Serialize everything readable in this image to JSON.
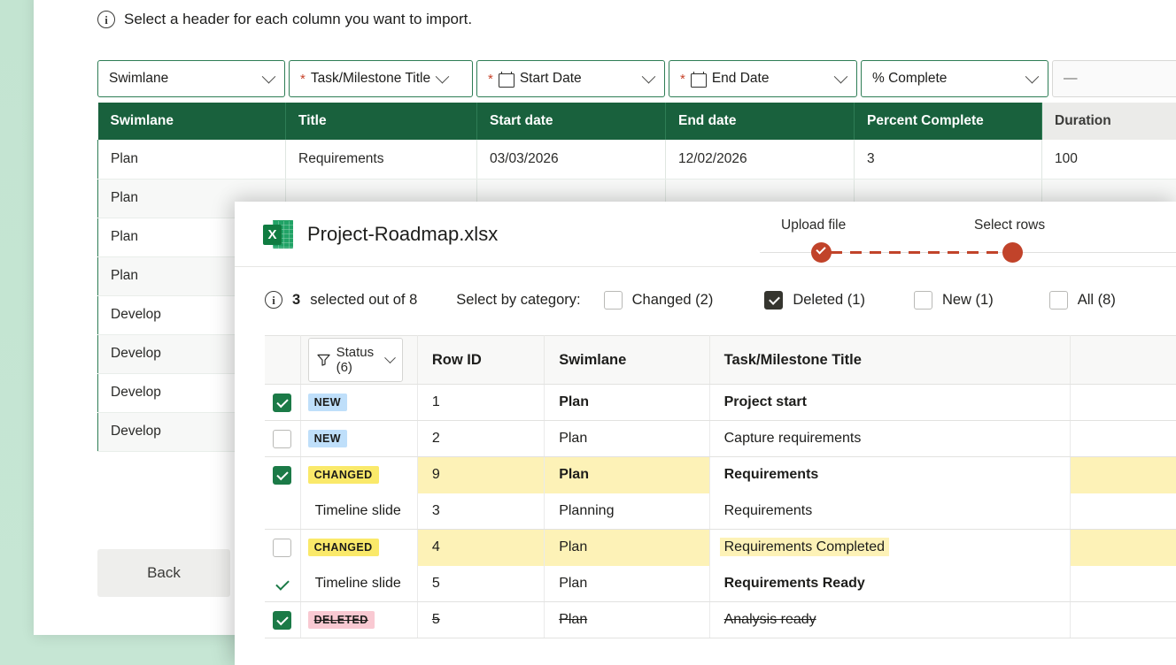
{
  "page": {
    "info_text": "Select a header for each column you want to import.",
    "back_label": "Back"
  },
  "mapping_selects": [
    {
      "label": "Swimlane",
      "required": false,
      "calendar": false
    },
    {
      "label": "Task/Milestone Title",
      "required": true,
      "calendar": false
    },
    {
      "label": "Start Date",
      "required": true,
      "calendar": true
    },
    {
      "label": "End Date",
      "required": true,
      "calendar": true
    },
    {
      "label": "% Complete",
      "required": false,
      "calendar": false
    },
    {
      "label": "—",
      "required": false,
      "calendar": false,
      "unmapped": true
    }
  ],
  "preview_table": {
    "headers": [
      "Swimlane",
      "Title",
      "Start date",
      "End date",
      "Percent Complete",
      "Duration"
    ],
    "rows": [
      {
        "swimlane": "Plan",
        "title": "Requirements",
        "start": "03/03/2026",
        "end": "12/02/2026",
        "percent": "3",
        "duration": "100"
      },
      {
        "swimlane": "Plan",
        "title": "",
        "start": "",
        "end": "",
        "percent": "",
        "duration": ""
      },
      {
        "swimlane": "Plan",
        "title": "",
        "start": "",
        "end": "",
        "percent": "",
        "duration": ""
      },
      {
        "swimlane": "Plan",
        "title": "",
        "start": "",
        "end": "",
        "percent": "",
        "duration": ""
      },
      {
        "swimlane": "Develop",
        "title": "",
        "start": "",
        "end": "",
        "percent": "",
        "duration": ""
      },
      {
        "swimlane": "Develop",
        "title": "",
        "start": "",
        "end": "",
        "percent": "",
        "duration": ""
      },
      {
        "swimlane": "Develop",
        "title": "",
        "start": "",
        "end": "",
        "percent": "",
        "duration": ""
      },
      {
        "swimlane": "Develop",
        "title": "",
        "start": "",
        "end": "",
        "percent": "",
        "duration": ""
      }
    ]
  },
  "modal": {
    "file_name": "Project-Roadmap.xlsx",
    "file_icon": "excel-icon",
    "steps": [
      {
        "label": "Upload file",
        "state": "complete"
      },
      {
        "label": "Select rows",
        "state": "current"
      }
    ],
    "selection": {
      "count_prefix": "3",
      "count_text": "selected out of 8",
      "category_label": "Select by category:",
      "categories": [
        {
          "label": "Changed (2)",
          "checked": false
        },
        {
          "label": "Deleted (1)",
          "checked": true
        },
        {
          "label": "New (1)",
          "checked": false
        },
        {
          "label": "All (8)",
          "checked": false
        }
      ]
    },
    "table": {
      "filter_label": "Status (6)",
      "headers": [
        "Row ID",
        "Swimlane",
        "Task/Milestone Title"
      ],
      "rows": [
        {
          "check": "checked-box",
          "status": "NEW",
          "status_kind": "new",
          "row_id": "1",
          "swimlane": "Plan",
          "title": "Project start",
          "bold": true
        },
        {
          "check": "empty-box",
          "status": "NEW",
          "status_kind": "new",
          "row_id": "2",
          "swimlane": "Plan",
          "title": "Capture requirements",
          "bold": false
        },
        {
          "check": "checked-box",
          "status": "CHANGED",
          "status_kind": "changed",
          "row_id": "9",
          "swimlane": "Plan",
          "title": "Requirements",
          "bold": true,
          "highlight": true,
          "extra_highlight": true
        },
        {
          "check": "none",
          "status": "Timeline slide",
          "status_kind": "subtext",
          "row_id": "3",
          "swimlane": "Planning",
          "title": "Requirements",
          "bold": false
        },
        {
          "check": "empty-box",
          "status": "CHANGED",
          "status_kind": "changed",
          "row_id": "4",
          "swimlane": "Plan",
          "title": "Requirements Completed",
          "bold": false,
          "highlight": true,
          "title_highlight": true,
          "extra_highlight": true
        },
        {
          "check": "tick",
          "status": "Timeline slide",
          "status_kind": "plain",
          "row_id": "5",
          "swimlane": "Plan",
          "title": "Requirements Ready",
          "bold": true
        },
        {
          "check": "checked-box",
          "status": "DELETED",
          "status_kind": "deleted",
          "row_id": "5",
          "swimlane": "Plan",
          "title": "Analysis ready",
          "bold": false,
          "strike": true
        }
      ]
    }
  },
  "colors": {
    "header_green": "#19613d",
    "accent_orange": "#c1432a",
    "check_green": "#1b7a47",
    "highlight_yellow": "#fdf2b7",
    "badge_new": "#bfdffa",
    "badge_changed": "#fae96a",
    "badge_deleted": "#f9c9d2",
    "page_bg": "#c3e4d1"
  }
}
